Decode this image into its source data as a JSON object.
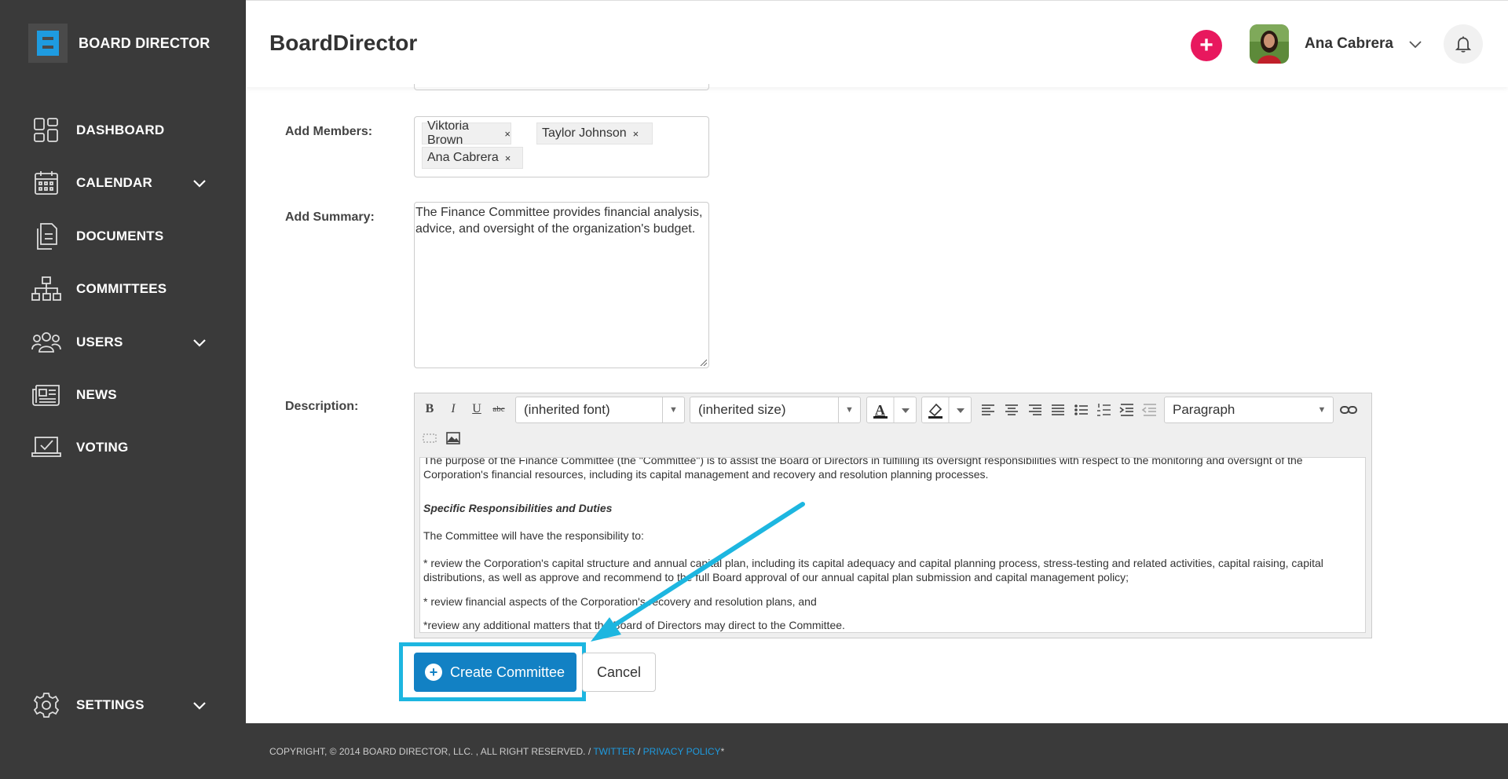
{
  "brand": {
    "name": "BOARD DIRECTOR"
  },
  "sidebar": {
    "items": [
      {
        "label": "DASHBOARD",
        "icon": "dashboard-icon",
        "has_submenu": false
      },
      {
        "label": "CALENDAR",
        "icon": "calendar-icon",
        "has_submenu": true
      },
      {
        "label": "DOCUMENTS",
        "icon": "documents-icon",
        "has_submenu": false
      },
      {
        "label": "COMMITTEES",
        "icon": "committees-icon",
        "has_submenu": false
      },
      {
        "label": "USERS",
        "icon": "users-icon",
        "has_submenu": true
      },
      {
        "label": "NEWS",
        "icon": "news-icon",
        "has_submenu": false
      },
      {
        "label": "VOTING",
        "icon": "voting-icon",
        "has_submenu": false
      }
    ],
    "settings": {
      "label": "SETTINGS",
      "icon": "gear-icon",
      "has_submenu": true
    }
  },
  "header": {
    "title": "BoardDirector",
    "add_button": "+",
    "user_name": "Ana Cabrera"
  },
  "form": {
    "members": {
      "label": "Add Members:",
      "tags": [
        "Viktoria Brown",
        "Taylor Johnson",
        "Ana Cabrera"
      ],
      "remove_glyph": "×"
    },
    "summary": {
      "label": "Add Summary:",
      "value": "The Finance Committee provides financial analysis, advice, and oversight of the organization's budget."
    },
    "description": {
      "label": "Description:",
      "toolbar": {
        "bold": "B",
        "italic": "I",
        "underline": "U",
        "strike": "abc",
        "font": "(inherited font)",
        "size": "(inherited size)",
        "block_format": "Paragraph"
      },
      "content": {
        "p1": "The purpose of the Finance Committee (the \"Committee\") is to assist the Board of Directors in fulfilling its oversight responsibilities with respect to the monitoring and oversight of the Corporation's financial resources, including its capital management and recovery and resolution planning processes.",
        "heading": "Specific Responsibilities and Duties",
        "p2": "The Committee will have the responsibility to:",
        "p3": "* review the Corporation's capital structure and annual capital plan, including its capital adequacy and capital planning process, stress-testing and related activities, capital raising, capital distributions, as well as approve and recommend to the full Board approval of our annual capital plan submission and capital management policy;",
        "p4": "* review financial aspects of the Corporation's recovery and resolution plans, and",
        "p5": "*review any additional matters that the Board of Directors may direct to the Committee."
      }
    },
    "create_button": "Create Committee",
    "cancel_button": "Cancel"
  },
  "footer": {
    "copyright": "COPYRIGHT, © 2014 BOARD DIRECTOR, LLC. , ALL RIGHT RESERVED. / ",
    "twitter": "TWITTER",
    "separator": " / ",
    "privacy": "PRIVACY POLICY",
    "asterisk": "*"
  },
  "colors": {
    "sidebar_bg": "#3a3a3a",
    "accent_blue": "#1281c4",
    "highlight_cyan": "#1db6e0",
    "add_pink": "#e8185e"
  }
}
